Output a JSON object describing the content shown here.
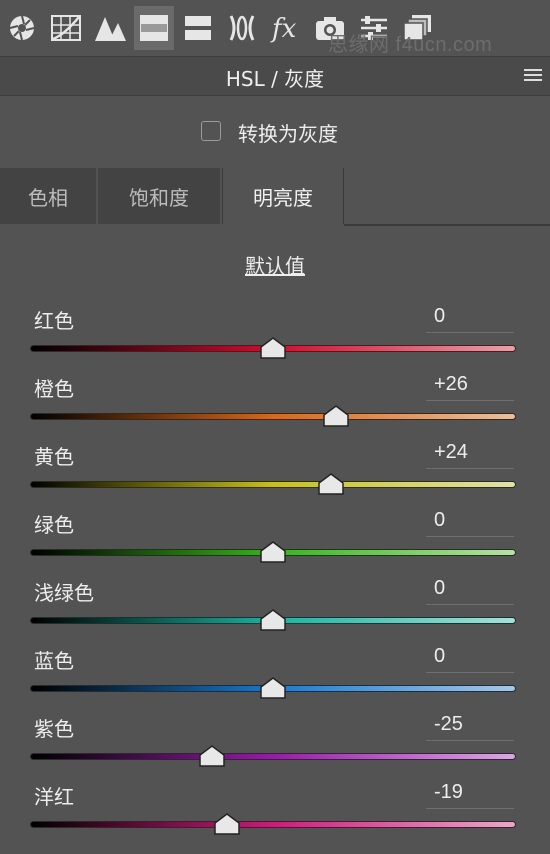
{
  "toolbar": {
    "icons": [
      "aperture-icon",
      "tone-curve-icon",
      "detail-icon",
      "hsl-icon",
      "split-toning-icon",
      "lens-icon",
      "fx-icon",
      "camera-icon",
      "presets-icon",
      "snapshots-icon"
    ],
    "active": "hsl-icon",
    "watermark": "思缘网 f4ucn.com"
  },
  "header": {
    "title": "HSL / 灰度"
  },
  "grayscale": {
    "label": "转换为灰度",
    "checked": false
  },
  "tabs": [
    {
      "label": "色相",
      "active": false
    },
    {
      "label": "饱和度",
      "active": false
    },
    {
      "label": "明亮度",
      "active": true
    }
  ],
  "default_label": "默认值",
  "sliders": [
    {
      "label": "红色",
      "value": "0",
      "level": 0,
      "gradient": [
        "#000000",
        "#c8102e",
        "#e8a0a8"
      ]
    },
    {
      "label": "橙色",
      "value": "+26",
      "level": 26,
      "gradient": [
        "#000000",
        "#d2691e",
        "#e8c0a0"
      ]
    },
    {
      "label": "黄色",
      "value": "+24",
      "level": 24,
      "gradient": [
        "#000000",
        "#c8c020",
        "#e0e0b0"
      ]
    },
    {
      "label": "绿色",
      "value": "0",
      "level": 0,
      "gradient": [
        "#000000",
        "#3cb020",
        "#b8e0a8"
      ]
    },
    {
      "label": "浅绿色",
      "value": "0",
      "level": 0,
      "gradient": [
        "#000000",
        "#20b0a0",
        "#a8e0d8"
      ]
    },
    {
      "label": "蓝色",
      "value": "0",
      "level": 0,
      "gradient": [
        "#000000",
        "#1e78c8",
        "#a8c8e8"
      ]
    },
    {
      "label": "紫色",
      "value": "-25",
      "level": -25,
      "gradient": [
        "#000000",
        "#9020a0",
        "#d8a8e0"
      ]
    },
    {
      "label": "洋红",
      "value": "-19",
      "level": -19,
      "gradient": [
        "#000000",
        "#c81e78",
        "#e8a8c8"
      ]
    }
  ],
  "slider_range": [
    -100,
    100
  ]
}
